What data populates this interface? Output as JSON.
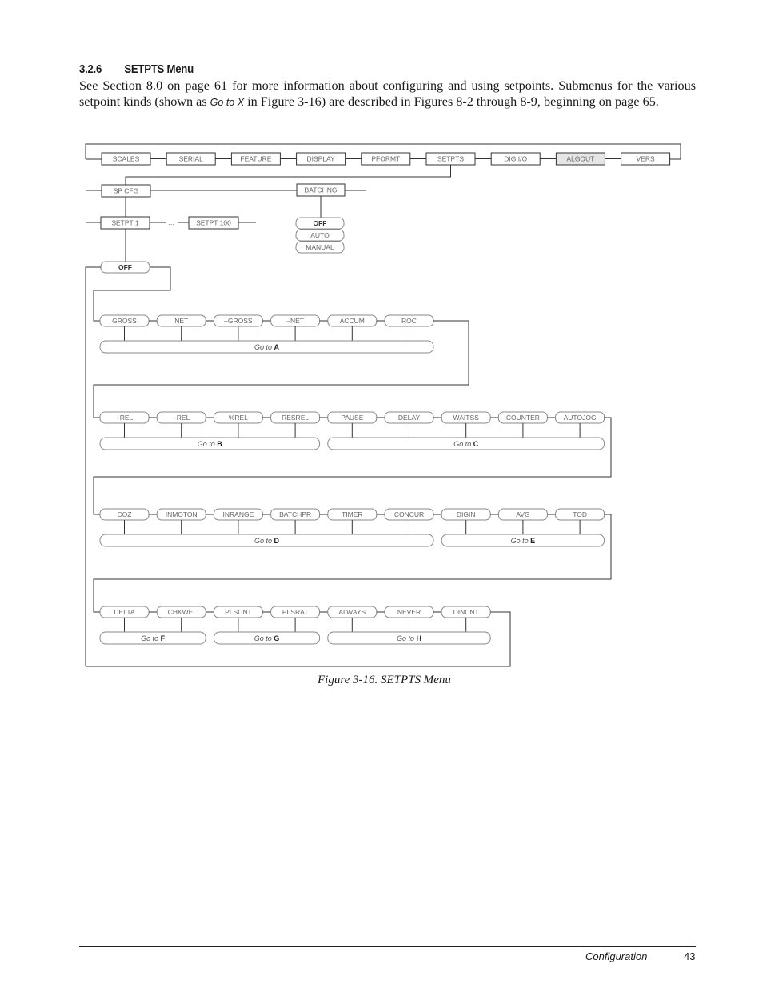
{
  "heading": {
    "number": "3.2.6",
    "title": "SETPTS Menu"
  },
  "intro": {
    "part1": "See Section 8.0 on page 61 for more information about configuring and using setpoints. Submenus for the various setpoint kinds (shown as ",
    "goto_inline": "Go to X",
    "part2": " in Figure 3-16) are described in Figures 8-2 through 8-9, beginning on page 65."
  },
  "diagram": {
    "top_menu": [
      {
        "label": "SCALES",
        "highlighted": false
      },
      {
        "label": "SERIAL",
        "highlighted": false
      },
      {
        "label": "FEATURE",
        "highlighted": false
      },
      {
        "label": "DISPLAY",
        "highlighted": false
      },
      {
        "label": "PFORMT",
        "highlighted": false
      },
      {
        "label": "SETPTS",
        "highlighted": false
      },
      {
        "label": "DIG I/O",
        "highlighted": false
      },
      {
        "label": "ALGOUT",
        "highlighted": true
      },
      {
        "label": "VERS",
        "highlighted": false
      }
    ],
    "highlight_color": "#e6e6e6",
    "setpts_submenu": [
      "SP CFG",
      "BATCHNG"
    ],
    "batching_options": [
      {
        "label": "OFF",
        "default": true
      },
      {
        "label": "AUTO",
        "default": false
      },
      {
        "label": "MANUAL",
        "default": false
      }
    ],
    "setpoint_items": [
      "SETPT 1",
      "SETPT 100"
    ],
    "ellipsis": "...",
    "kind_default": "OFF",
    "goto_prefix": "Go to",
    "kind_rows": [
      {
        "kinds": [
          "GROSS",
          "NET",
          "–GROSS",
          "–NET",
          "ACCUM",
          "ROC"
        ],
        "groups": [
          {
            "target": "A",
            "kinds": [
              0,
              1,
              2,
              3,
              4,
              5
            ]
          }
        ]
      },
      {
        "kinds": [
          "+REL",
          "–REL",
          "%REL",
          "RESREL",
          "PAUSE",
          "DELAY",
          "WAITSS",
          "COUNTER",
          "AUTOJOG"
        ],
        "groups": [
          {
            "target": "B",
            "kinds": [
              0,
              1,
              2,
              3
            ]
          },
          {
            "target": "C",
            "kinds": [
              4,
              5,
              6,
              7,
              8
            ]
          }
        ]
      },
      {
        "kinds": [
          "COZ",
          "INMOTON",
          "INRANGE",
          "BATCHPR",
          "TIMER",
          "CONCUR",
          "DIGIN",
          "AVG",
          "TOD"
        ],
        "groups": [
          {
            "target": "D",
            "kinds": [
              0,
              1,
              2,
              3,
              4,
              5
            ]
          },
          {
            "target": "E",
            "kinds": [
              6,
              7,
              8
            ]
          }
        ]
      },
      {
        "kinds": [
          "DELTA",
          "CHKWEI",
          "PLSCNT",
          "PLSRAT",
          "ALWAYS",
          "NEVER",
          "DINCNT"
        ],
        "groups": [
          {
            "target": "F",
            "kinds": [
              0,
              1
            ]
          },
          {
            "target": "G",
            "kinds": [
              2,
              3
            ]
          },
          {
            "target": "H",
            "kinds": [
              4,
              5,
              6
            ]
          }
        ]
      }
    ]
  },
  "caption": "Figure 3-16. SETPTS Menu",
  "footer": {
    "section": "Configuration",
    "page": "43"
  }
}
